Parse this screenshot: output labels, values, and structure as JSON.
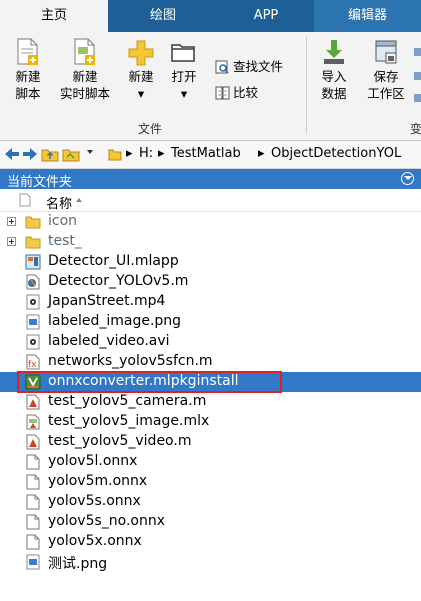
{
  "tabs": [
    {
      "label": "主页",
      "active": true
    },
    {
      "label": "绘图",
      "active": false
    },
    {
      "label": "APP",
      "active": false
    },
    {
      "label": "编辑器",
      "active": false
    }
  ],
  "ribbon": {
    "new_script": {
      "line1": "新建",
      "line2": "脚本"
    },
    "new_live_script": {
      "line1": "新建",
      "line2": "实时脚本"
    },
    "new_menu": {
      "line1": "新建"
    },
    "open_menu": {
      "line1": "打开"
    },
    "find_files": "查找文件",
    "compare": "比较",
    "import_data": {
      "line1": "导入",
      "line2": "数据"
    },
    "save_workspace": {
      "line1": "保存",
      "line2": "工作区"
    },
    "group_file": "文件",
    "group_variable_partial": "变"
  },
  "address": {
    "separator": "▸",
    "segments": [
      "H:",
      "TestMatlab",
      "ObjectDetectionYOL"
    ]
  },
  "panel": {
    "title": "当前文件夹",
    "column_name": "名称"
  },
  "files": [
    {
      "name": "icon",
      "type": "folder",
      "expandable": true
    },
    {
      "name": "test_",
      "type": "folder",
      "expandable": true
    },
    {
      "name": "Detector_UI.mlapp",
      "type": "mlapp"
    },
    {
      "name": "Detector_YOLOv5.m",
      "type": "class-m"
    },
    {
      "name": "JapanStreet.mp4",
      "type": "video"
    },
    {
      "name": "labeled_image.png",
      "type": "image"
    },
    {
      "name": "labeled_video.avi",
      "type": "video"
    },
    {
      "name": "networks_yolov5sfcn.m",
      "type": "function-m"
    },
    {
      "name": "onnxconverter.mlpkginstall",
      "type": "mlpkginstall",
      "selected": true
    },
    {
      "name": "test_yolov5_camera.m",
      "type": "script-m"
    },
    {
      "name": "test_yolov5_image.mlx",
      "type": "mlx"
    },
    {
      "name": "test_yolov5_video.m",
      "type": "script-m"
    },
    {
      "name": "yolov5l.onnx",
      "type": "file"
    },
    {
      "name": "yolov5m.onnx",
      "type": "file"
    },
    {
      "name": "yolov5s.onnx",
      "type": "file"
    },
    {
      "name": "yolov5s_no.onnx",
      "type": "file"
    },
    {
      "name": "yolov5x.onnx",
      "type": "file"
    },
    {
      "name": "测试.png",
      "type": "image"
    }
  ],
  "colors": {
    "tab_bar": "#1d5f96",
    "panel_header": "#3178c6",
    "selection": "#3178c6",
    "highlight_box": "#e02020"
  }
}
